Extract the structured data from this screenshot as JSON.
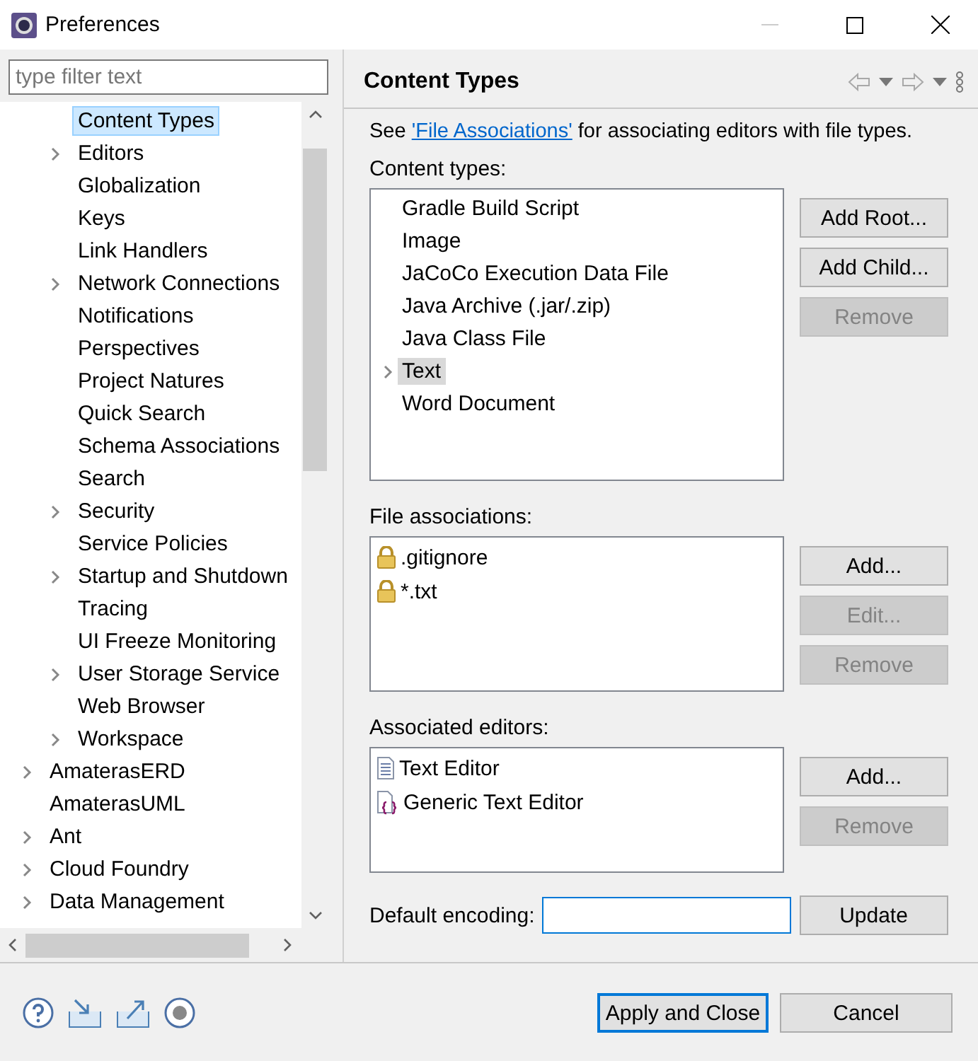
{
  "window": {
    "title": "Preferences"
  },
  "filter": {
    "placeholder": "type filter text"
  },
  "tree": {
    "items": [
      {
        "children": [
          {
            "label": "Content Types",
            "has_children": false,
            "selected": true
          },
          {
            "label": "Editors",
            "has_children": true,
            "selected": false
          },
          {
            "label": "Globalization",
            "has_children": false,
            "selected": false
          },
          {
            "label": "Keys",
            "has_children": false,
            "selected": false
          },
          {
            "label": "Link Handlers",
            "has_children": false,
            "selected": false
          },
          {
            "label": "Network Connections",
            "has_children": true,
            "selected": false
          },
          {
            "label": "Notifications",
            "has_children": false,
            "selected": false
          },
          {
            "label": "Perspectives",
            "has_children": false,
            "selected": false
          },
          {
            "label": "Project Natures",
            "has_children": false,
            "selected": false
          },
          {
            "label": "Quick Search",
            "has_children": false,
            "selected": false
          },
          {
            "label": "Schema Associations",
            "has_children": false,
            "selected": false
          },
          {
            "label": "Search",
            "has_children": false,
            "selected": false
          },
          {
            "label": "Security",
            "has_children": true,
            "selected": false
          },
          {
            "label": "Service Policies",
            "has_children": false,
            "selected": false
          },
          {
            "label": "Startup and Shutdown",
            "has_children": true,
            "selected": false
          },
          {
            "label": "Tracing",
            "has_children": false,
            "selected": false
          },
          {
            "label": "UI Freeze Monitoring",
            "has_children": false,
            "selected": false
          },
          {
            "label": "User Storage Service",
            "has_children": true,
            "selected": false
          },
          {
            "label": "Web Browser",
            "has_children": false,
            "selected": false
          },
          {
            "label": "Workspace",
            "has_children": true,
            "selected": false
          }
        ]
      },
      {
        "label": "AmaterasERD",
        "has_children": true,
        "selected": false
      },
      {
        "label": "AmaterasUML",
        "has_children": false,
        "selected": false
      },
      {
        "label": "Ant",
        "has_children": true,
        "selected": false
      },
      {
        "label": "Cloud Foundry",
        "has_children": true,
        "selected": false
      },
      {
        "label": "Data Management",
        "has_children": true,
        "selected": false
      }
    ]
  },
  "page": {
    "title": "Content Types",
    "intro_before": "See ",
    "link": "'File Associations'",
    "intro_after": " for associating editors with file types."
  },
  "content_types": {
    "label": "Content types:",
    "items": [
      {
        "label": "Gradle Build Script",
        "has_children": false,
        "selected": false
      },
      {
        "label": "Image",
        "has_children": false,
        "selected": false
      },
      {
        "label": "JaCoCo Execution Data File",
        "has_children": false,
        "selected": false
      },
      {
        "label": "Java Archive (.jar/.zip)",
        "has_children": false,
        "selected": false
      },
      {
        "label": "Java Class File",
        "has_children": false,
        "selected": false
      },
      {
        "label": "Text",
        "has_children": true,
        "selected": true
      },
      {
        "label": "Word Document",
        "has_children": false,
        "selected": false
      }
    ],
    "buttons": [
      {
        "label": "Add Root...",
        "disabled": false
      },
      {
        "label": "Add Child...",
        "disabled": false
      },
      {
        "label": "Remove",
        "disabled": true
      }
    ]
  },
  "file_associations": {
    "label": "File associations:",
    "items": [
      {
        "label": ".gitignore"
      },
      {
        "label": "*.txt"
      }
    ],
    "buttons": [
      {
        "label": "Add...",
        "disabled": false
      },
      {
        "label": "Edit...",
        "disabled": true
      },
      {
        "label": "Remove",
        "disabled": true
      }
    ]
  },
  "associated_editors": {
    "label": "Associated editors:",
    "items": [
      {
        "label": "Text Editor",
        "kind": "text"
      },
      {
        "label": "Generic Text Editor",
        "kind": "generic"
      }
    ],
    "buttons": [
      {
        "label": "Add...",
        "disabled": false
      },
      {
        "label": "Remove",
        "disabled": true
      }
    ]
  },
  "encoding": {
    "label": "Default encoding:",
    "button": "Update"
  },
  "footer_buttons": [
    {
      "label": "Apply and Close",
      "default": true
    },
    {
      "label": "Cancel",
      "default": false
    }
  ]
}
